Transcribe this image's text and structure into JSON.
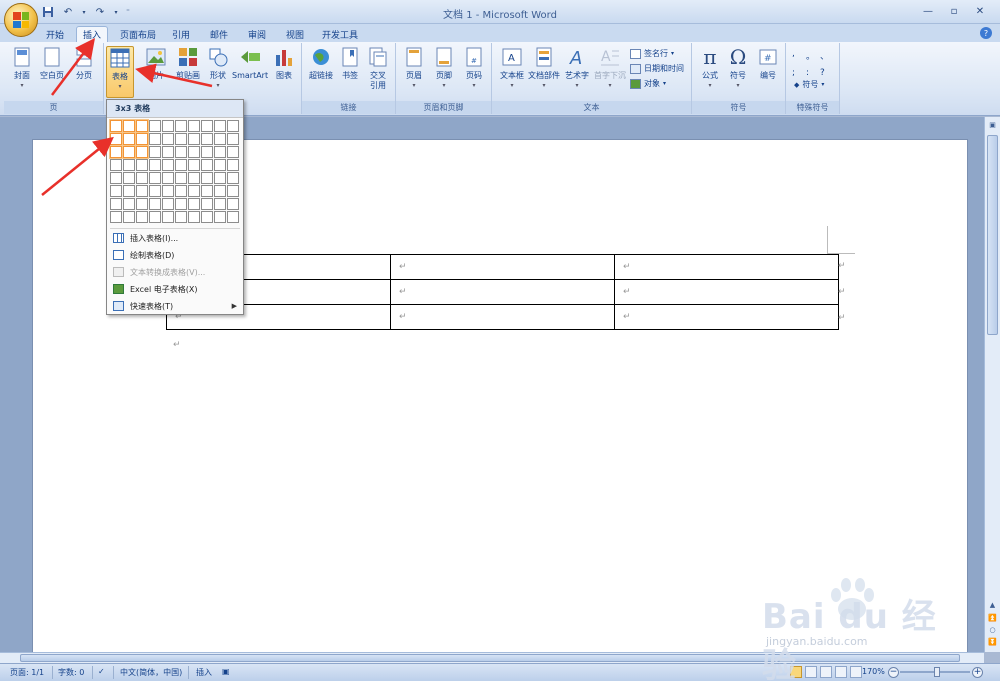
{
  "window": {
    "title": "文档 1 - Microsoft Word"
  },
  "qat": {
    "save": "保存",
    "undo": "撤消",
    "redo": "恢复"
  },
  "tabs": [
    {
      "label": "开始"
    },
    {
      "label": "插入"
    },
    {
      "label": "页面布局"
    },
    {
      "label": "引用"
    },
    {
      "label": "邮件"
    },
    {
      "label": "审阅"
    },
    {
      "label": "视图"
    },
    {
      "label": "开发工具"
    }
  ],
  "ribbon": {
    "groups": {
      "pages": "页",
      "links": "链接",
      "header_footer": "页眉和页脚",
      "text": "文本",
      "symbols": "符号",
      "special_symbols": "特殊符号"
    },
    "buttons": {
      "cover": "封面",
      "blank_page": "空白页",
      "page_break": "分页",
      "table": "表格",
      "picture": "图片",
      "clip_art": "剪贴画",
      "shapes": "形状",
      "smartart": "SmartArt",
      "chart": "图表",
      "hyperlink": "超链接",
      "bookmark": "书签",
      "cross_ref_1": "交叉",
      "cross_ref_2": "引用",
      "header": "页眉",
      "footer": "页脚",
      "page_number": "页码",
      "textbox": "文本框",
      "quick_parts": "文档部件",
      "wordart": "艺术字",
      "drop_cap": "首字下沉",
      "signature_line": "签名行",
      "date_time": "日期和时间",
      "object": "对象",
      "equation": "公式",
      "symbol": "符号",
      "numbering": "编号",
      "special_symbol": "符号"
    },
    "special_chars": [
      ",",
      "。",
      "、",
      ";",
      ":",
      "?"
    ]
  },
  "table_dropdown": {
    "header": "3x3 表格",
    "grid_cols": 10,
    "grid_rows": 8,
    "selected_cols": 3,
    "selected_rows": 3,
    "items": [
      {
        "label": "插入表格(I)...",
        "disabled": false
      },
      {
        "label": "绘制表格(D)",
        "disabled": false
      },
      {
        "label": "文本转换成表格(V)...",
        "disabled": true
      },
      {
        "label": "Excel 电子表格(X)",
        "disabled": false
      },
      {
        "label": "快速表格(T)",
        "disabled": false
      }
    ]
  },
  "document": {
    "cell_mark": "↵",
    "paragraph_mark": "↵"
  },
  "statusbar": {
    "page": "页面: 1/1",
    "words": "字数: 0",
    "language": "中文(简体，中国)",
    "mode": "插入",
    "zoom": "170%"
  },
  "watermark": {
    "brand": "Bai du 经验",
    "url": "jingyan.baidu.com"
  },
  "colors": {
    "ribbon_bg": "#dbe6f5",
    "accent_orange": "#f29436",
    "arrow_red": "#e8302a",
    "tab_text": "#15428b"
  }
}
